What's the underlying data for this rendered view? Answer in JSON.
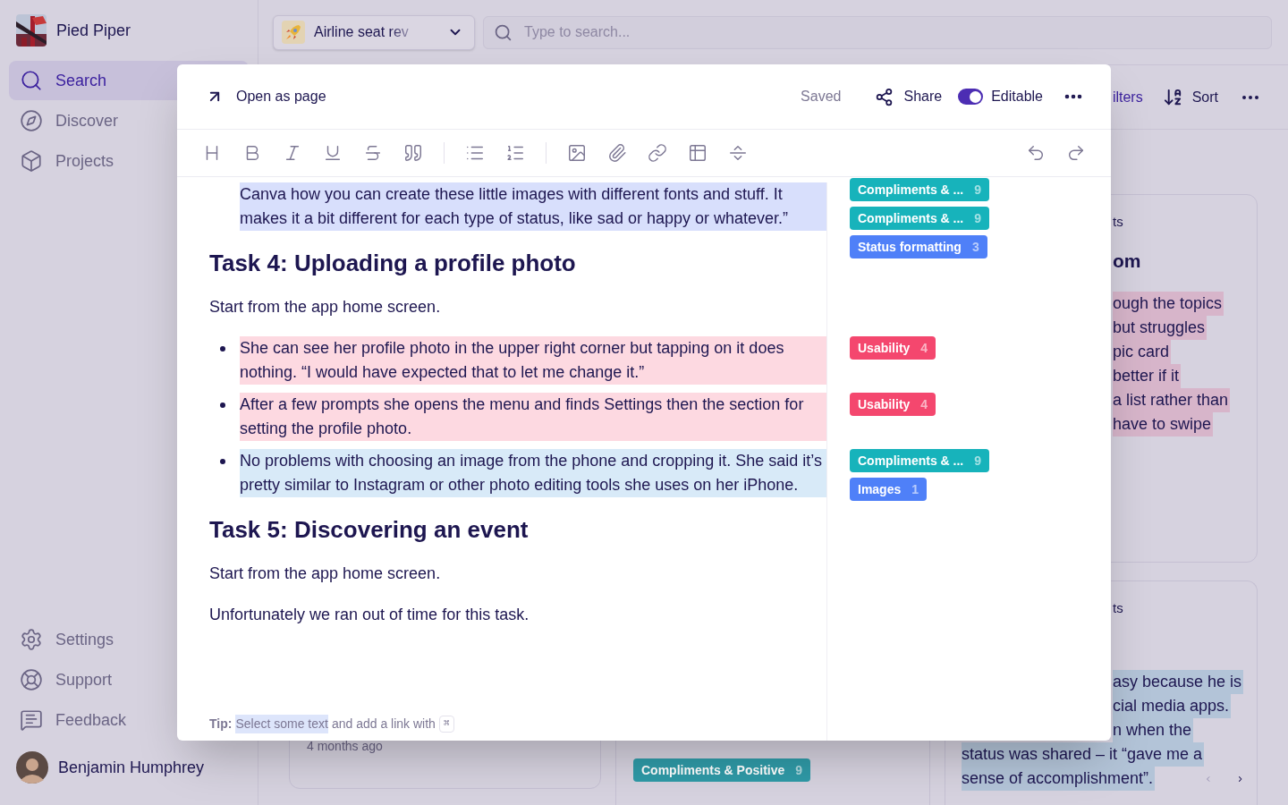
{
  "sidebar": {
    "workspace": "Pied Piper",
    "items": [
      {
        "label": "Search",
        "selected": true
      },
      {
        "label": "Discover",
        "selected": false
      },
      {
        "label": "Projects",
        "selected": false
      }
    ],
    "footer_items": [
      {
        "label": "Settings"
      },
      {
        "label": "Support"
      },
      {
        "label": "Feedback"
      }
    ],
    "user": "Benjamin Humphrey"
  },
  "topbar": {
    "project": "Airline seat rev",
    "search": {
      "placeholder": "Type to search..."
    }
  },
  "toolbar": {
    "filters": "ilters",
    "sort": "Sort"
  },
  "background_cards": {
    "left": {
      "time": "4 months ago"
    },
    "middle": {
      "tag": {
        "label": "Compliments & Positive",
        "count": "9",
        "color": "#2f9aa7"
      }
    },
    "right_top": {
      "line_1": "ts",
      "heading": "om",
      "lines": [
        "ough the topics",
        "but struggles",
        "pic card",
        "better if it",
        "a list rather than",
        "have to swipe"
      ],
      "color": "#d7b5ca"
    },
    "right_bottom": {
      "line_1": "ts",
      "lines": [
        "asy because he is",
        "cial media apps.",
        "n when the"
      ],
      "full_lines": [
        "status was shared – it “gave me a",
        "sense of accomplishment”."
      ],
      "color": "#b3c4d8"
    }
  },
  "modal": {
    "open_as_page": "Open as page",
    "status": "Saved",
    "share": "Share",
    "editable": {
      "label": "Editable",
      "on": true
    },
    "blocks": [
      {
        "kind": "bullet",
        "bullet_shown": false,
        "text": "Canva how you can create these little images with different fonts and stuff. It makes it a bit different for each type of status, like sad or happy or whatever.”",
        "color": "#d8dffc",
        "tags": [
          {
            "label": "Compliments & ...",
            "count": "9",
            "color": "#17b3bb"
          },
          {
            "label": "Compliments & ...",
            "count": "9",
            "color": "#17b3bb"
          },
          {
            "label": "Status formatting",
            "count": "3",
            "color": "#4f80f8"
          }
        ]
      },
      {
        "kind": "heading",
        "text": "Task 4: Uploading a profile photo"
      },
      {
        "kind": "paragraph",
        "text": "Start from the app home screen."
      },
      {
        "kind": "bullet",
        "bullet_shown": true,
        "text": "She can see her profile photo in the upper right corner but tapping on it does nothing. “I would have expected that to let me change it.”",
        "color": "#fdd9e1",
        "tags": [
          {
            "label": "Usability",
            "count": "4",
            "color": "#f4476e"
          }
        ]
      },
      {
        "kind": "bullet",
        "bullet_shown": true,
        "text": "After a few prompts she opens the menu and finds Settings then the section for setting the profile photo.",
        "color": "#fdd9e1",
        "tags": [
          {
            "label": "Usability",
            "count": "4",
            "color": "#f4476e"
          }
        ]
      },
      {
        "kind": "bullet",
        "bullet_shown": true,
        "text": "No problems with choosing an image from the phone and cropping it. She said it’s pretty similar to Instagram or other photo editing tools she uses on her iPhone.",
        "color": "#d8eaf8",
        "tags": [
          {
            "label": "Compliments & ...",
            "count": "9",
            "color": "#17b3bb"
          },
          {
            "label": "Images",
            "count": "1",
            "color": "#4f80f8"
          }
        ]
      },
      {
        "kind": "heading",
        "text": "Task 5: Discovering an event"
      },
      {
        "kind": "paragraph",
        "text": "Start from the app home screen."
      },
      {
        "kind": "paragraph",
        "text": "Unfortunately we ran out of time for this task."
      }
    ],
    "tip": {
      "label": "Tip:",
      "highlight": "Select some text",
      "rest": "and add a link with",
      "key": "⌘"
    }
  }
}
